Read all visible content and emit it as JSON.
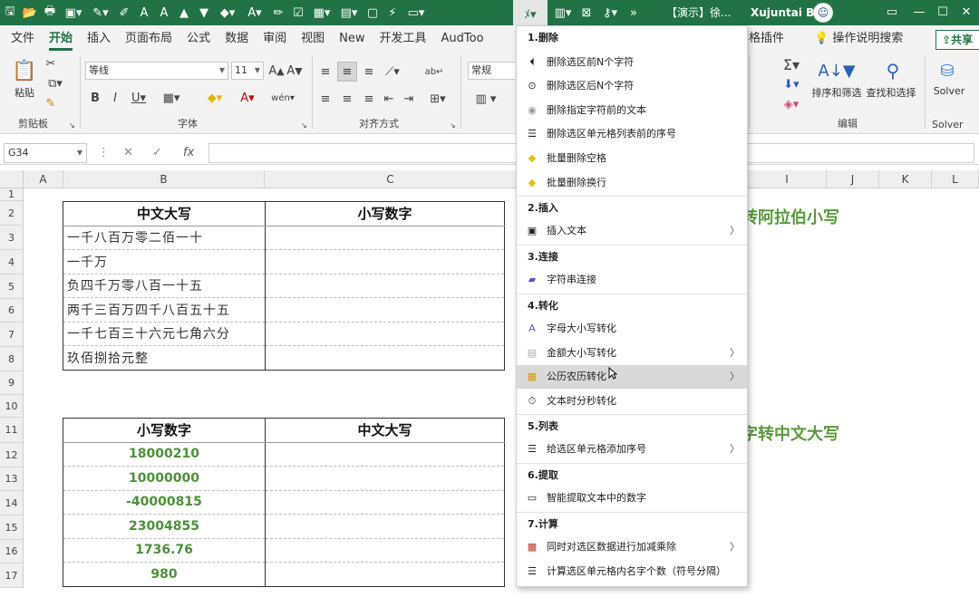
{
  "titlebar": {
    "title": "【演示】徐...",
    "user": "Xujuntai BG",
    "minimize_icon": "minimize-icon",
    "maximize_icon": "maximize-icon",
    "close_icon": "close-icon"
  },
  "tabs": [
    "文件",
    "开始",
    "插入",
    "页面布局",
    "公式",
    "数据",
    "审阅",
    "视图",
    "New",
    "开发工具",
    "AudToo"
  ],
  "tabs_right": {
    "plugin": "方格插件",
    "help": "操作说明搜索",
    "share": "共享"
  },
  "ribbon": {
    "paste": "粘贴",
    "clipboard": "剪贴板",
    "font_name": "等线",
    "font_size": "11",
    "font_group": "字体",
    "align_group": "对齐方式",
    "number_format": "常规",
    "edit_group": "编辑",
    "sort_filter": "排序和筛选",
    "find_select": "查找和选择",
    "solver_btn": "Solver",
    "solver_group": "Solver"
  },
  "formula_bar": {
    "cell_ref": "G34",
    "cancel": "✕",
    "enter": "✓",
    "fx": "fx"
  },
  "columns": [
    "A",
    "B",
    "C",
    "I",
    "J",
    "K",
    "L"
  ],
  "rows": [
    "1",
    "2",
    "3",
    "4",
    "5",
    "6",
    "7",
    "8",
    "9",
    "10",
    "11",
    "12",
    "13",
    "14",
    "15",
    "16",
    "17"
  ],
  "table1": {
    "headers": [
      "中文大写",
      "小写数字"
    ],
    "rows": [
      "一千八百万零二佰一十",
      "一千万",
      "负四千万零八百一十五",
      "两千三百万四千八百五十五",
      "一千七百三十六元七角六分",
      "玖佰捌拾元整"
    ]
  },
  "table2": {
    "headers": [
      "小写数字",
      "中文大写"
    ],
    "rows": [
      "18000210",
      "10000000",
      "-40000815",
      "23004855",
      "1736.76",
      "980"
    ]
  },
  "headings": {
    "h1": "转阿拉伯小写",
    "h2": "字转中文大写"
  },
  "menu": {
    "s1": "1.删除",
    "s1_items": [
      "删除选区前N个字符",
      "删除选区后N个字符",
      "删除指定字符前的文本",
      "删除选区单元格列表前的序号",
      "批量删除空格",
      "批量删除换行"
    ],
    "s2": "2.插入",
    "s2_items": [
      "插入文本"
    ],
    "s3": "3.连接",
    "s3_items": [
      "字符串连接"
    ],
    "s4": "4.转化",
    "s4_items": [
      "字母大小写转化",
      "金额大小写转化",
      "公历农历转化",
      "文本时分秒转化"
    ],
    "s5": "5.列表",
    "s5_items": [
      "给选区单元格添加序号"
    ],
    "s6": "6.提取",
    "s6_items": [
      "智能提取文本中的数字"
    ],
    "s7": "7.计算",
    "s7_items": [
      "同时对选区数据进行加减乘除",
      "计算选区单元格内名字个数（符号分隔）"
    ]
  },
  "colors": {
    "excel_green": "#217346",
    "number_green": "#4e8f3a",
    "heading_green": "#5a9a3c",
    "menu_highlight": "#d9d9d9"
  }
}
